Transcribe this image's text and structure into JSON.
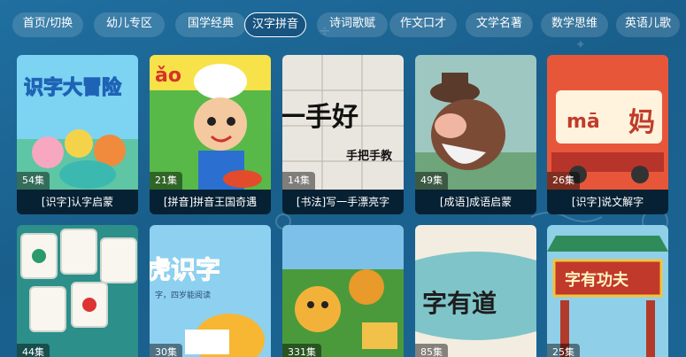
{
  "tabs": [
    {
      "label": "首页/切换",
      "active": false
    },
    {
      "label": "幼儿专区",
      "active": false
    },
    {
      "label": "国学经典",
      "active": false
    },
    {
      "label": "汉字拼音",
      "active": true
    },
    {
      "label": "诗词歌赋",
      "active": false
    },
    {
      "label": "作文口才",
      "active": false
    },
    {
      "label": "文学名著",
      "active": false
    },
    {
      "label": "数学思维",
      "active": false
    },
    {
      "label": "英语儿歌",
      "active": false
    }
  ],
  "cards_row1": [
    {
      "title": "[识字]认字启蒙",
      "episodes": "54集",
      "thumb_text": "识字大冒险",
      "thumb_icon": "cartoon-characters-icon"
    },
    {
      "title": "[拼音]拼音王国奇遇",
      "episodes": "21集",
      "thumb_text": "ǎo",
      "thumb_icon": "chef-boy-icon"
    },
    {
      "title": "[书法]写一手漂亮字",
      "episodes": "14集",
      "thumb_text": "一手好",
      "thumb_text2": "手把手教",
      "thumb_icon": "calligraphy-icon"
    },
    {
      "title": "[成语]成语启蒙",
      "episodes": "49集",
      "thumb_text": "",
      "thumb_icon": "old-man-icon"
    },
    {
      "title": "[识字]说文解字",
      "episodes": "26集",
      "thumb_text": "mā",
      "thumb_text2": "妈",
      "thumb_icon": "pinyin-card-icon"
    }
  ],
  "cards_row2": [
    {
      "episodes": "44集",
      "thumb_text": "",
      "thumb_icon": "mahjong-tiles-icon"
    },
    {
      "episodes": "30集",
      "thumb_text": "虎识字",
      "thumb_text2": "字，四岁能阅读",
      "thumb_icon": "tiger-book-icon"
    },
    {
      "episodes": "331集",
      "thumb_text": "",
      "thumb_icon": "cartoon-tigers-icon"
    },
    {
      "episodes": "85集",
      "thumb_text": "字有道",
      "thumb_icon": "hand-lettering-icon"
    },
    {
      "episodes": "25集",
      "thumb_text": "字有功夫",
      "thumb_icon": "kungfu-gate-icon"
    }
  ]
}
